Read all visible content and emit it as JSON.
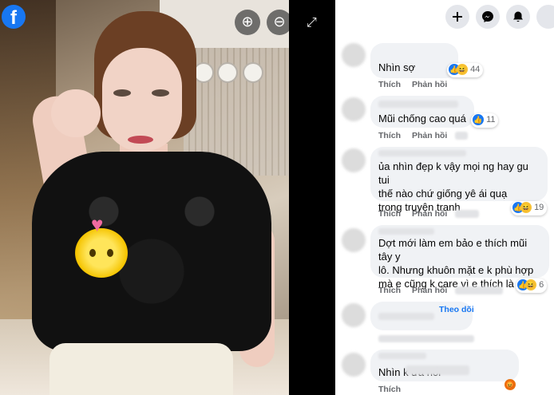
{
  "header": {
    "brand_icon": "facebook-logo-icon",
    "buttons": [
      "plus-icon",
      "messenger-icon",
      "notifications-bell-icon"
    ]
  },
  "viewer": {
    "zoom_in_icon": "zoom-in-icon",
    "zoom_out_icon": "zoom-out-icon",
    "expand_icon": "expand-icon",
    "zoom_in_glyph": "⊕",
    "zoom_out_glyph": "⊖",
    "expand_glyph": "⤢",
    "brand_letter": "f"
  },
  "comments": [
    {
      "text": "Nhìn sợ",
      "actions": [
        "Thích",
        "Phản hồi"
      ],
      "reaction_count": "44"
    },
    {
      "text": "Mũi chống cao quá",
      "actions": [
        "Thích",
        "Phản hồi"
      ],
      "reaction_count": "11"
    },
    {
      "text_lines": [
        "ủa nhìn đẹp k vậy mọi ng hay gu tui",
        "thế nào chứ giống yê      ái quạ",
        "trong truyện tranh"
      ],
      "actions": [
        "Thích",
        "Phản hồi"
      ],
      "reaction_count": "19"
    },
    {
      "text_lines": [
        "Dợt mới làm em bảo e thích mũi tây y",
        "lô. Nhưng khuôn mặt e k phù hợp",
        "mà e cũng k care vì e thích là dx."
      ],
      "actions": [
        "Thích",
        "Phản hồi"
      ],
      "reaction_count": "6"
    },
    {
      "text": "",
      "follow_label": "Theo dõi"
    },
    {
      "text": "Nhìn                    k ưa nổi",
      "actions": [
        "Thích"
      ]
    }
  ],
  "colors": {
    "accent": "#1877f2",
    "bubble": "#f0f2f5",
    "meta": "#65676b"
  }
}
